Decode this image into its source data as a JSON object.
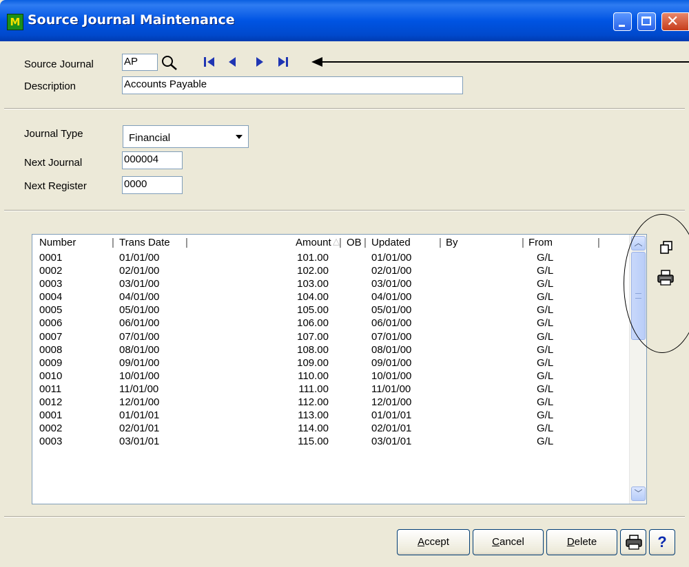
{
  "window": {
    "title": "Source Journal Maintenance",
    "app_icon_letter": "M"
  },
  "header": {
    "source_journal_label": "Source Journal",
    "source_journal_value": "AP",
    "description_label": "Description",
    "description_value": "Accounts Payable"
  },
  "journal": {
    "type_label": "Journal Type",
    "type_value": "Financial",
    "next_journal_label": "Next Journal",
    "next_journal_value": "000004",
    "next_register_label": "Next Register",
    "next_register_value": "0000"
  },
  "grid": {
    "columns": [
      "Number",
      "Trans Date",
      "Amount",
      "OB",
      "Updated",
      "By",
      "From"
    ],
    "rows": [
      [
        "0001",
        "01/01/00",
        "101.00",
        "01/01/00",
        "",
        "G/L"
      ],
      [
        "0002",
        "02/01/00",
        "102.00",
        "02/01/00",
        "",
        "G/L"
      ],
      [
        "0003",
        "03/01/00",
        "103.00",
        "03/01/00",
        "",
        "G/L"
      ],
      [
        "0004",
        "04/01/00",
        "104.00",
        "04/01/00",
        "",
        "G/L"
      ],
      [
        "0005",
        "05/01/00",
        "105.00",
        "05/01/00",
        "",
        "G/L"
      ],
      [
        "0006",
        "06/01/00",
        "106.00",
        "06/01/00",
        "",
        "G/L"
      ],
      [
        "0007",
        "07/01/00",
        "107.00",
        "07/01/00",
        "",
        "G/L"
      ],
      [
        "0008",
        "08/01/00",
        "108.00",
        "08/01/00",
        "",
        "G/L"
      ],
      [
        "0009",
        "09/01/00",
        "109.00",
        "09/01/00",
        "",
        "G/L"
      ],
      [
        "0010",
        "10/01/00",
        "110.00",
        "10/01/00",
        "",
        "G/L"
      ],
      [
        "0011",
        "11/01/00",
        "111.00",
        "11/01/00",
        "",
        "G/L"
      ],
      [
        "0012",
        "12/01/00",
        "112.00",
        "12/01/00",
        "",
        "G/L"
      ],
      [
        "0001",
        "01/01/01",
        "113.00",
        "01/01/01",
        "",
        "G/L"
      ],
      [
        "0002",
        "02/01/01",
        "114.00",
        "02/01/01",
        "",
        "G/L"
      ],
      [
        "0003",
        "03/01/01",
        "115.00",
        "03/01/01",
        "",
        "G/L"
      ]
    ]
  },
  "buttons": {
    "accept_first": "A",
    "accept_rest": "ccept",
    "cancel_first": "C",
    "cancel_rest": "ancel",
    "delete_first": "D",
    "delete_rest": "elete",
    "help": "?"
  },
  "icons": {
    "lookup": "magnifier-icon",
    "first": "first-record-icon",
    "prev": "previous-record-icon",
    "next": "next-record-icon",
    "last": "last-record-icon",
    "copy": "copy-icon",
    "print": "printer-icon"
  },
  "colors": {
    "titlebar": "#0054e3",
    "nav_arrows": "#1f35b3",
    "window_bg": "#ece9d8"
  }
}
